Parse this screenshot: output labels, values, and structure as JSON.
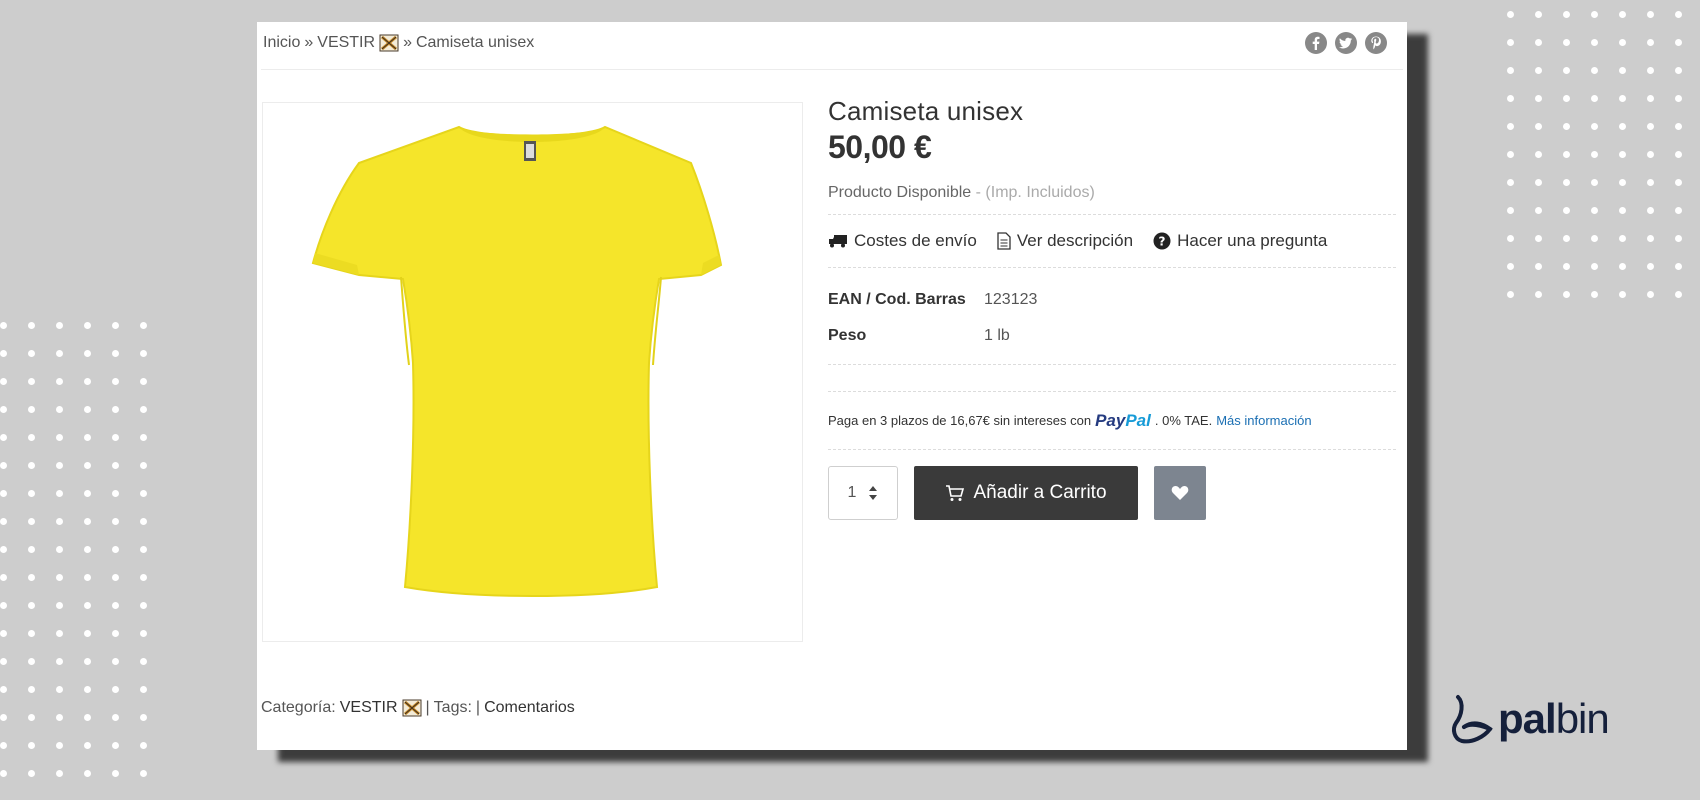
{
  "breadcrumb": {
    "home": "Inicio",
    "sep": "»",
    "category": "VESTIR",
    "category_icon": "crossed-bones-emoji-icon",
    "current": "Camiseta unisex"
  },
  "share_icons": [
    "facebook-icon",
    "twitter-icon",
    "pinterest-icon"
  ],
  "product": {
    "title": "Camiseta unisex",
    "price": "50,00 €",
    "availability": "Producto Disponible",
    "tax_note": "- (Imp. Incluidos)",
    "image_color": "#f5e52a"
  },
  "actions": {
    "shipping": "Costes de envío",
    "description": "Ver descripción",
    "question": "Hacer una pregunta"
  },
  "specs": [
    {
      "key": "EAN / Cod. Barras",
      "value": "123123"
    },
    {
      "key": "Peso",
      "value": "1 lb"
    }
  ],
  "paypal": {
    "text_before": "Paga en 3 plazos de 16,67€ sin intereses con",
    "logo_a": "Pay",
    "logo_b": "Pal",
    "text_after": ". 0% TAE.",
    "link": "Más información"
  },
  "buy": {
    "quantity": "1",
    "cart_label": "Añadir a Carrito"
  },
  "footer": {
    "category_label": "Categoría:",
    "category": "VESTIR",
    "sep": "|",
    "tags_label": "Tags:",
    "comments": "Comentarios"
  },
  "brand": {
    "bold": "pal",
    "light": "bin"
  },
  "colors": {
    "background": "#cdcdcd",
    "cart_button": "#3a3a3a",
    "wishlist_button": "#7d8590",
    "brand": "#15203b"
  }
}
